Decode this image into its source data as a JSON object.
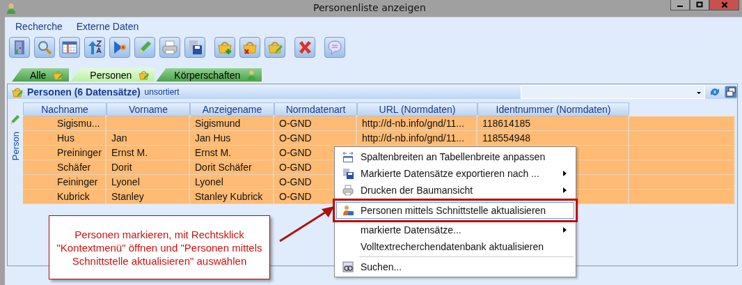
{
  "window": {
    "title": "Personenliste anzeigen"
  },
  "menu": [
    "Recherche",
    "Externe Daten"
  ],
  "tabs": [
    {
      "label": "Alle",
      "selected": false
    },
    {
      "label": "Personen",
      "selected": true
    },
    {
      "label": "Körperschaften",
      "selected": false
    }
  ],
  "panel": {
    "title": "Personen (6 Datensätze)",
    "sort_status": "unsortiert",
    "side_label": "Person"
  },
  "table": {
    "columns": [
      "Nachname",
      "Vorname",
      "Anzeigename",
      "Normdatenart",
      "URL (Normdaten)",
      "Identnummer (Normdaten)"
    ],
    "rows": [
      {
        "selected": true,
        "cells": [
          "Sigismu...",
          "",
          "Sigismund",
          "O-GND",
          "http://d-nb.info/gnd/11...",
          "118614185"
        ]
      },
      {
        "selected": true,
        "cells": [
          "Hus",
          "Jan",
          "Jan Hus",
          "O-GND",
          "http://d-nb.info/gnd/11...",
          "118554948"
        ]
      },
      {
        "selected": true,
        "cells": [
          "Preininger",
          "Ernst M.",
          "Ernst M.",
          "O-GND",
          "",
          ""
        ]
      },
      {
        "selected": true,
        "cells": [
          "Schäfer",
          "Dorit",
          "Dorit Schäfer",
          "O-GND",
          "",
          ""
        ]
      },
      {
        "selected": true,
        "cells": [
          "Feininger",
          "Lyonel",
          "Lyonel",
          "O-GND",
          "",
          ""
        ]
      },
      {
        "selected": true,
        "cells": [
          "Kubrick",
          "Stanley",
          "Stanley Kubrick",
          "O-GND",
          "",
          ""
        ]
      }
    ]
  },
  "context_menu": [
    {
      "label": "Spaltenbreiten an Tabellenbreite anpassen",
      "submenu": false,
      "selected": false,
      "separator_before": false
    },
    {
      "label": "Markierte Datensätze exportieren nach ...",
      "submenu": true,
      "selected": false,
      "separator_before": false
    },
    {
      "label": "Drucken der Baumansicht",
      "submenu": true,
      "selected": false,
      "separator_before": false
    },
    {
      "label": "Personen mittels Schnittstelle aktualisieren",
      "submenu": false,
      "selected": true,
      "separator_before": true
    },
    {
      "label": "markierte Datensätze...",
      "submenu": true,
      "selected": false,
      "separator_before": false
    },
    {
      "label": "Volltextrecherchendatenbank aktualisieren",
      "submenu": false,
      "selected": false,
      "separator_before": false
    },
    {
      "label": "Suchen...",
      "submenu": false,
      "selected": false,
      "separator_before": true
    }
  ],
  "callout": {
    "text": "Personen markieren, mit Rechtsklick \"Kontextmenü\" öffnen und \"Personen mittels Schnittstelle aktualisieren\" auswählen"
  }
}
